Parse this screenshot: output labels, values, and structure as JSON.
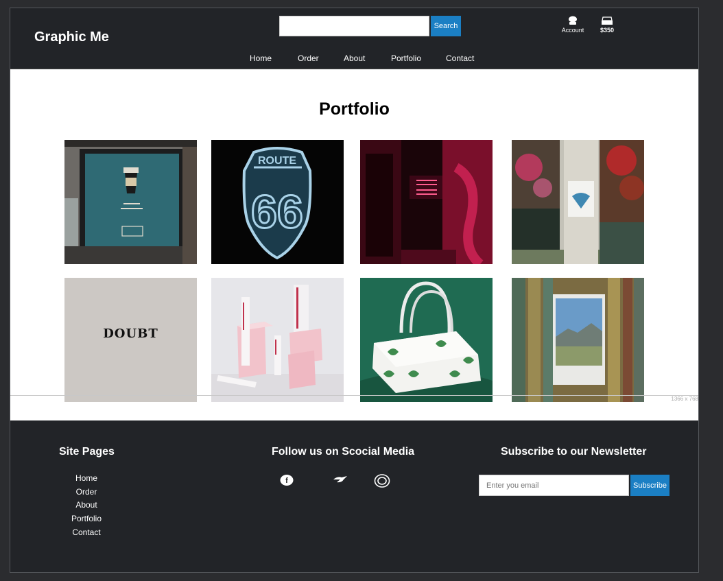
{
  "header": {
    "logo": "Graphic Me",
    "search_button": "Search",
    "account_label": "Account",
    "cart_total": "$350",
    "account_icon": "user-icon",
    "cart_icon": "cart-icon"
  },
  "nav": {
    "items": [
      {
        "label": "Home"
      },
      {
        "label": "Order"
      },
      {
        "label": "About"
      },
      {
        "label": "Portfolio"
      },
      {
        "label": "Contact"
      }
    ]
  },
  "main": {
    "title": "Portfolio",
    "viewport_label": "1366 x 768",
    "tiles": [
      {
        "subject": "coffee-poster"
      },
      {
        "subject": "route-66-sign"
      },
      {
        "subject": "neon-sign"
      },
      {
        "subject": "earth-sticker"
      },
      {
        "subject": "doubt-logo",
        "text": "DOUBT"
      },
      {
        "subject": "cosmetic-packaging"
      },
      {
        "subject": "leaf-bag"
      },
      {
        "subject": "polaroid-on-wood"
      }
    ]
  },
  "footer": {
    "site_pages_heading": "Site Pages",
    "links": [
      {
        "label": "Home"
      },
      {
        "label": "Order"
      },
      {
        "label": "About"
      },
      {
        "label": "Portfolio"
      },
      {
        "label": "Contact"
      }
    ],
    "social_heading": "Follow us on Scocial Media",
    "social_icons": [
      "facebook-icon",
      "twitter-icon",
      "instagram-icon"
    ],
    "newsletter_heading": "Subscribe to our Newsletter",
    "newsletter_placeholder": "Enter you email",
    "subscribe_button": "Subscribe"
  },
  "colors": {
    "header_bg": "#222428",
    "accent": "#1b7fc4",
    "page_bg": "#ffffff"
  }
}
